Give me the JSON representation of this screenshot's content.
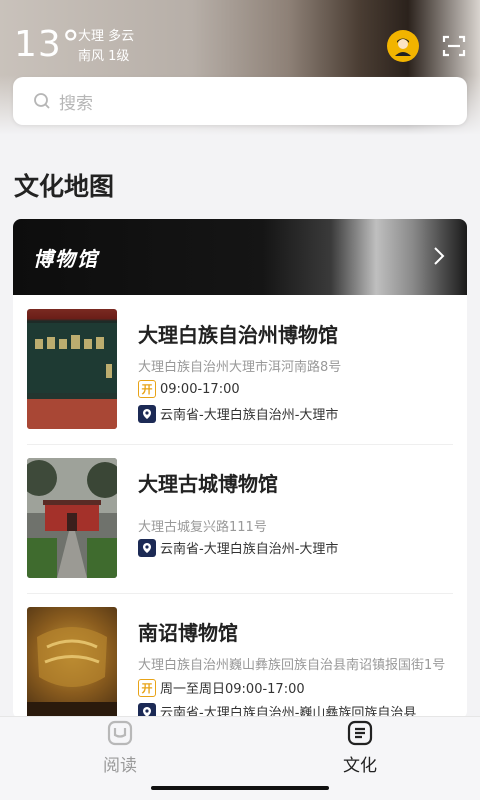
{
  "weather": {
    "temperature": "13°",
    "city_condition": "大理 多云",
    "wind": "南风 1级"
  },
  "search": {
    "placeholder": "搜索"
  },
  "section": {
    "title": "文化地图"
  },
  "category": {
    "title": "博物馆"
  },
  "museums": [
    {
      "name": "大理白族自治州博物馆",
      "address": "大理白族自治州大理市洱河南路8号",
      "hours": "09:00-17:00",
      "region": "云南省-大理白族自治州-大理市",
      "open_badge": "开"
    },
    {
      "name": "大理古城博物馆",
      "address": "大理古城复兴路111号",
      "region": "云南省-大理白族自治州-大理市"
    },
    {
      "name": "南诏博物馆",
      "address": "大理白族自治州巍山彝族回族自治县南诏镇报国街1号",
      "hours": "周一至周日09:00-17:00",
      "region": "云南省-大理白族自治州-巍山彝族回族自治县",
      "open_badge": "开"
    }
  ],
  "tabs": [
    {
      "label": "阅读",
      "active": false
    },
    {
      "label": "文化",
      "active": true
    }
  ],
  "colors": {
    "accent": "#e8a317",
    "location_badge": "#1c2a55",
    "active_tab": "#222222",
    "inactive_tab": "#9a9a9a"
  }
}
